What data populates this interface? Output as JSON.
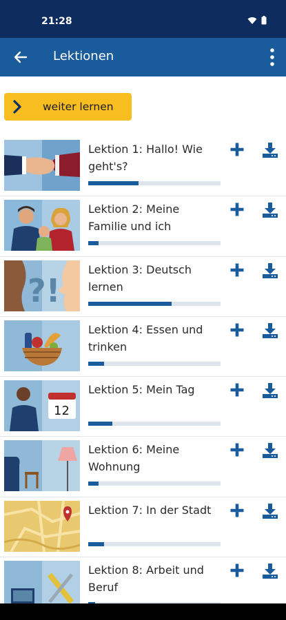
{
  "status_bar": {
    "time": "21:28"
  },
  "app_bar": {
    "title": "Lektionen"
  },
  "continue_button": {
    "label": "weiter lernen"
  },
  "colors": {
    "primary": "#1a5b9b",
    "status_bar": "#0f2c5e",
    "accent": "#f8bd1e"
  },
  "lessons": [
    {
      "title": "Lektion 1: Hallo! Wie geht's?",
      "progress": 0.38,
      "image": "handshake-image"
    },
    {
      "title": "Lektion 2: Meine Familie und ich",
      "progress": 0.08,
      "image": "family-image"
    },
    {
      "title": "Lektion 3: Deutsch lernen",
      "progress": 0.63,
      "image": "question-exclamation-image"
    },
    {
      "title": "Lektion 4: Essen und trinken",
      "progress": 0.12,
      "image": "food-basket-image"
    },
    {
      "title": "Lektion 5: Mein Tag",
      "progress": 0.18,
      "image": "calendar-man-image"
    },
    {
      "title": "Lektion 6: Meine Wohnung",
      "progress": 0.08,
      "image": "living-room-image"
    },
    {
      "title": "Lektion 7: In der Stadt",
      "progress": 0.12,
      "image": "city-map-image"
    },
    {
      "title": "Lektion 8: Arbeit und Beruf",
      "progress": 0.05,
      "image": "work-tools-image"
    }
  ]
}
